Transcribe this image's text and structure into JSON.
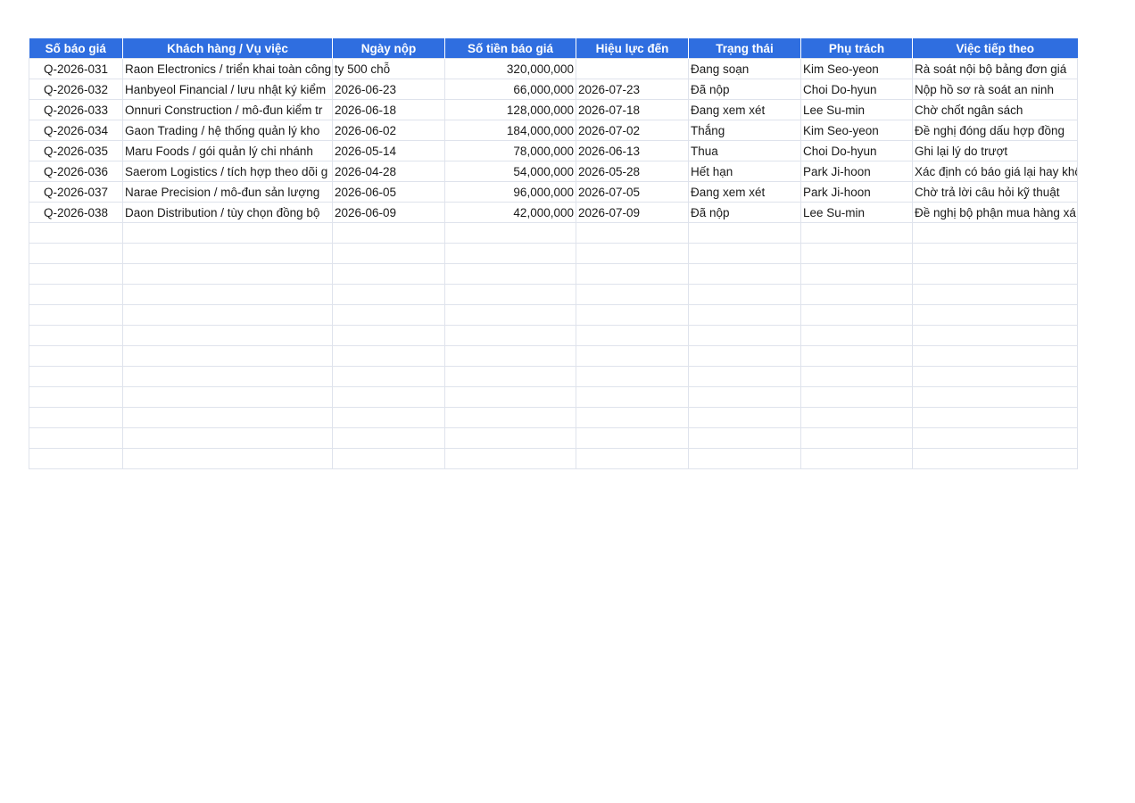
{
  "headers": [
    "Số báo giá",
    "Khách hàng / Vụ việc",
    "Ngày nộp",
    "Số tiền báo giá",
    "Hiệu lực đến",
    "Trạng thái",
    "Phụ trách",
    "Việc tiếp theo"
  ],
  "rows": [
    {
      "id": "Q-2026-031",
      "client": "Raon Electronics / triển khai toàn công ty 500 chỗ",
      "submitted": "",
      "amount": "320,000,000",
      "valid_until": "",
      "status": "Đang soạn",
      "owner": "Kim Seo-yeon",
      "next": "Rà soát nội bộ bảng đơn giá"
    },
    {
      "id": "Q-2026-032",
      "client": "Hanbyeol Financial / lưu nhật ký kiểm",
      "submitted": "2026-06-23",
      "amount": "66,000,000",
      "valid_until": "2026-07-23",
      "status": "Đã nộp",
      "owner": "Choi Do-hyun",
      "next": "Nộp hồ sơ rà soát an ninh"
    },
    {
      "id": "Q-2026-033",
      "client": "Onnuri Construction / mô-đun kiểm tr",
      "submitted": "2026-06-18",
      "amount": "128,000,000",
      "valid_until": "2026-07-18",
      "status": "Đang xem xét",
      "owner": "Lee Su-min",
      "next": "Chờ chốt ngân sách"
    },
    {
      "id": "Q-2026-034",
      "client": "Gaon Trading / hệ thống quản lý kho",
      "submitted": "2026-06-02",
      "amount": "184,000,000",
      "valid_until": "2026-07-02",
      "status": "Thắng",
      "owner": "Kim Seo-yeon",
      "next": "Đề nghị đóng dấu hợp đồng"
    },
    {
      "id": "Q-2026-035",
      "client": "Maru Foods / gói quản lý chi nhánh",
      "submitted": "2026-05-14",
      "amount": "78,000,000",
      "valid_until": "2026-06-13",
      "status": "Thua",
      "owner": "Choi Do-hyun",
      "next": "Ghi lại lý do trượt"
    },
    {
      "id": "Q-2026-036",
      "client": "Saerom Logistics / tích hợp theo dõi g",
      "submitted": "2026-04-28",
      "amount": "54,000,000",
      "valid_until": "2026-05-28",
      "status": "Hết hạn",
      "owner": "Park Ji-hoon",
      "next": "Xác định có báo giá lại hay khô"
    },
    {
      "id": "Q-2026-037",
      "client": "Narae Precision / mô-đun sản lượng",
      "submitted": "2026-06-05",
      "amount": "96,000,000",
      "valid_until": "2026-07-05",
      "status": "Đang xem xét",
      "owner": "Park Ji-hoon",
      "next": "Chờ trả lời câu hỏi kỹ thuật"
    },
    {
      "id": "Q-2026-038",
      "client": "Daon Distribution / tùy chọn đồng bộ",
      "submitted": "2026-06-09",
      "amount": "42,000,000",
      "valid_until": "2026-07-09",
      "status": "Đã nộp",
      "owner": "Lee Su-min",
      "next": "Đề nghị bộ phận mua hàng xá"
    }
  ],
  "empty_row_count": 12,
  "colors": {
    "header_bg": "#2f6ee0",
    "header_text": "#ffffff",
    "grid": "#dfe3ec"
  }
}
